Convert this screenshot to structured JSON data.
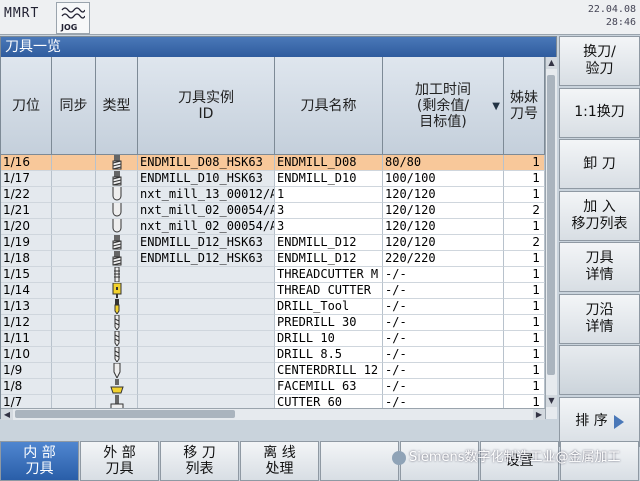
{
  "topbar": {
    "mode": "MMRT",
    "jog_label": "JOG",
    "date": "22.04.08",
    "time": "28:46"
  },
  "panel": {
    "title": "刀具一览"
  },
  "table": {
    "headers": {
      "pos": "刀位",
      "sync": "同步",
      "type": "类型",
      "instance": "刀具实例\nID",
      "name": "刀具名称",
      "time": "加工时间\n(剩余值/\n目标值)",
      "sister": "姊妹\n刀号"
    },
    "rows": [
      {
        "pos": "1/16",
        "icon": "endmill-icon",
        "instance": "ENDMILL_D08_HSK63",
        "name": "ENDMILL_D08",
        "time": "80/80",
        "sister": "1",
        "selected": true
      },
      {
        "pos": "1/17",
        "icon": "endmill-icon",
        "instance": "ENDMILL_D10_HSK63",
        "name": "ENDMILL_D10",
        "time": "100/100",
        "sister": "1"
      },
      {
        "pos": "1/22",
        "icon": "ballmill-icon",
        "instance": "nxt_mill_13_00012/A-",
        "name": "1",
        "time": "120/120",
        "sister": "1"
      },
      {
        "pos": "1/21",
        "icon": "ballmill-icon",
        "instance": "nxt_mill_02_00054/A-",
        "name": "3",
        "time": "120/120",
        "sister": "2"
      },
      {
        "pos": "1/20",
        "icon": "ballmill-icon",
        "instance": "nxt_mill_02_00054/A-",
        "name": "3",
        "time": "120/120",
        "sister": "1"
      },
      {
        "pos": "1/19",
        "icon": "endmill-icon",
        "instance": "ENDMILL_D12_HSK63",
        "name": "ENDMILL_D12",
        "time": "120/120",
        "sister": "2"
      },
      {
        "pos": "1/18",
        "icon": "endmill-icon",
        "instance": "ENDMILL_D12_HSK63",
        "name": "ENDMILL_D12",
        "time": "220/220",
        "sister": "1"
      },
      {
        "pos": "1/15",
        "icon": "threadcutter-icon",
        "instance": "",
        "name": "THREADCUTTER M",
        "time": "-/-",
        "sister": "1"
      },
      {
        "pos": "1/14",
        "icon": "threadcutter-yellow-icon",
        "instance": "",
        "name": "THREAD CUTTER",
        "time": "-/-",
        "sister": "1"
      },
      {
        "pos": "1/13",
        "icon": "drill-yellow-icon",
        "instance": "",
        "name": "DRILL_Tool",
        "time": "-/-",
        "sister": "1"
      },
      {
        "pos": "1/12",
        "icon": "drill-icon",
        "instance": "",
        "name": "PREDRILL 30",
        "time": "-/-",
        "sister": "1"
      },
      {
        "pos": "1/11",
        "icon": "drill-icon",
        "instance": "",
        "name": "DRILL 10",
        "time": "-/-",
        "sister": "1"
      },
      {
        "pos": "1/10",
        "icon": "drill-icon",
        "instance": "",
        "name": "DRILL 8.5",
        "time": "-/-",
        "sister": "1"
      },
      {
        "pos": "1/9",
        "icon": "centerdrill-icon",
        "instance": "",
        "name": "CENTERDRILL 12",
        "time": "-/-",
        "sister": "1"
      },
      {
        "pos": "1/8",
        "icon": "facemill-icon",
        "instance": "",
        "name": "FACEMILL 63",
        "time": "-/-",
        "sister": "1"
      },
      {
        "pos": "1/7",
        "icon": "cutter-icon",
        "instance": "",
        "name": "CUTTER 60",
        "time": "-/-",
        "sister": "1"
      }
    ]
  },
  "vsoftkeys": [
    {
      "id": "change-tool",
      "label": "换刀/\n验刀"
    },
    {
      "id": "one-to-one-change",
      "label": "1:1换刀"
    },
    {
      "id": "unload-tool",
      "label": "卸 刀"
    },
    {
      "id": "add-to-list",
      "label": "加 入\n移刀列表"
    },
    {
      "id": "tool-details",
      "label": "刀具\n详情"
    },
    {
      "id": "edge-details",
      "label": "刀沿\n详情"
    },
    {
      "id": "blank",
      "label": ""
    },
    {
      "id": "sort",
      "label": "排 序"
    }
  ],
  "hsoftkeys": [
    {
      "id": "internal-tools",
      "label": "内 部\n刀具",
      "active": true
    },
    {
      "id": "external-tools",
      "label": "外 部\n刀具"
    },
    {
      "id": "move-list",
      "label": "移 刀\n列表"
    },
    {
      "id": "offline-process",
      "label": "离 线\n处理"
    },
    {
      "id": "blank-1",
      "label": ""
    },
    {
      "id": "blank-2",
      "label": ""
    },
    {
      "id": "settings",
      "label": "设置"
    },
    {
      "id": "blank-3",
      "label": ""
    }
  ],
  "watermark": "Siemens数字化制造工业@金属加工",
  "colors": {
    "title_bar": "#2f5c9e",
    "selected_row": "#f8c89a",
    "active_softkey": "#2a5ea8"
  }
}
